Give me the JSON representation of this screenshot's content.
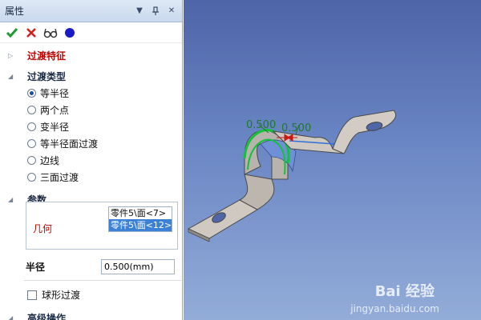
{
  "panel": {
    "title": "属性",
    "header_buttons": [
      "chevron-down-icon",
      "pin-icon",
      "close-icon"
    ]
  },
  "toolbar": {
    "icons": [
      "ok-check-icon",
      "cancel-x-icon",
      "preview-glasses-icon",
      "blue-circle-icon"
    ],
    "colors": {
      "ok": "#1f9a2f",
      "cancel": "#d21f1f",
      "circle": "#1a1ac8"
    }
  },
  "feature_section": {
    "label": "过渡特征"
  },
  "type_section": {
    "label": "过渡类型",
    "options": [
      "等半径",
      "两个点",
      "变半径",
      "等半径面过渡",
      "边线",
      "三面过渡"
    ],
    "selected": 0
  },
  "params_section": {
    "label": "参数",
    "geometry_label": "几何",
    "geometry_items": [
      "零件5\\面<7>",
      "零件5\\面<12>"
    ],
    "geometry_selected": 1
  },
  "radius": {
    "label": "半径",
    "value": "0.500(mm)"
  },
  "ball_fillet": {
    "label": "球形过渡",
    "checked": false
  },
  "advanced_section": {
    "label": "高级操作"
  },
  "viewport": {
    "dimension_labels": [
      "0.500",
      "0.500"
    ],
    "background_top": "#4e65a7",
    "background_bottom": "#93acd8"
  },
  "watermark": {
    "logo": "Bai 经验",
    "url": "jingyan.baidu.com"
  }
}
